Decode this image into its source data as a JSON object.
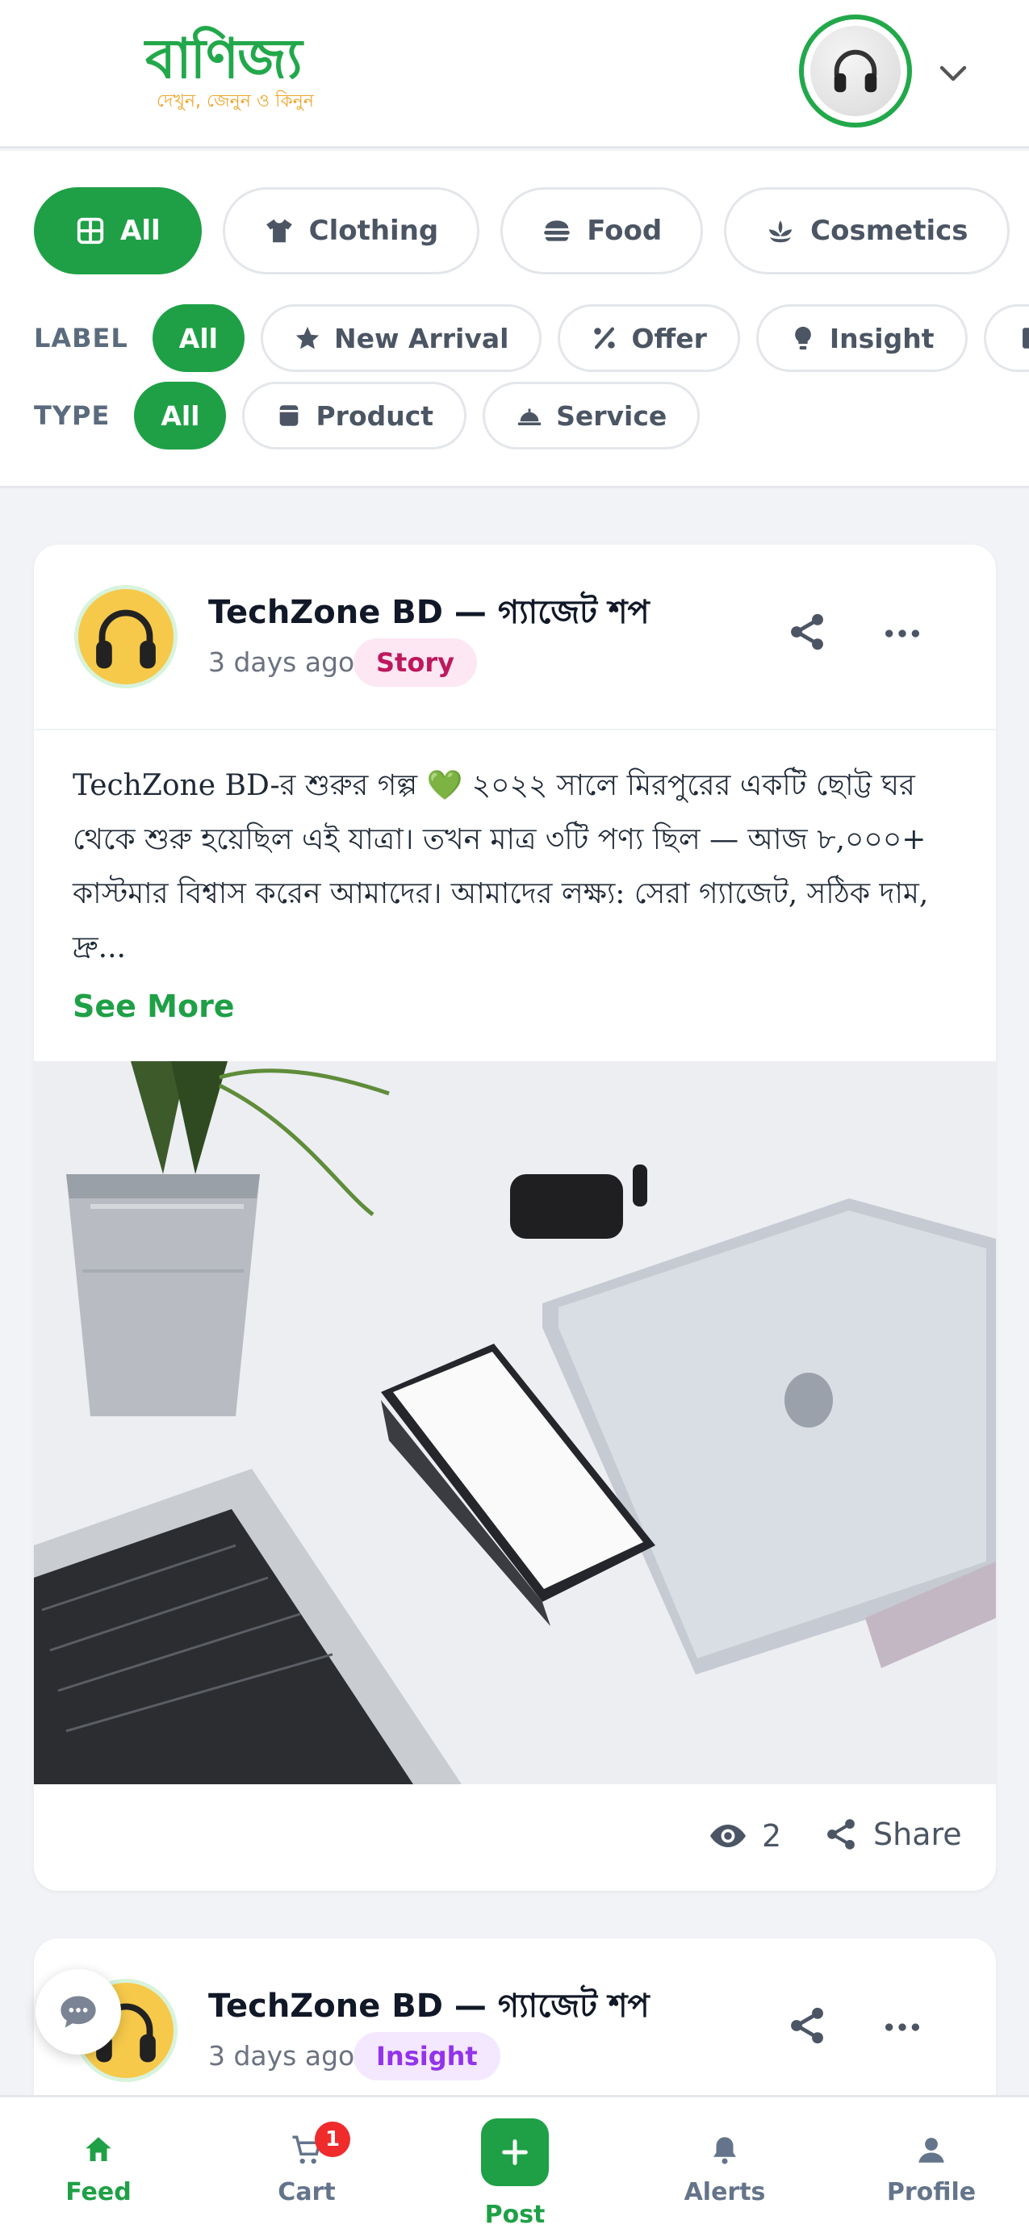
{
  "header": {
    "logo_text": "বাণিজ্য",
    "logo_tagline": "দেখুন, জেনুন ও কিনুন"
  },
  "filters": {
    "categories": [
      {
        "label": "All",
        "icon": "grid-icon",
        "active": true
      },
      {
        "label": "Clothing",
        "icon": "shirt-icon"
      },
      {
        "label": "Food",
        "icon": "burger-icon"
      },
      {
        "label": "Cosmetics",
        "icon": "lotus-icon"
      }
    ],
    "label_row_title": "LABEL",
    "labels": [
      {
        "label": "All",
        "active": true
      },
      {
        "label": "New Arrival",
        "icon": "star-icon"
      },
      {
        "label": "Offer",
        "icon": "percent-icon"
      },
      {
        "label": "Insight",
        "icon": "lightbulb-icon"
      }
    ],
    "type_row_title": "TYPE",
    "types": [
      {
        "label": "All",
        "active": true
      },
      {
        "label": "Product",
        "icon": "box-icon"
      },
      {
        "label": "Service",
        "icon": "bell-service-icon"
      }
    ]
  },
  "posts": [
    {
      "shop_name": "TechZone BD — গ্যাজেট শপ",
      "time": "3 days ago",
      "tag": "Story",
      "text": "TechZone BD-র শুরুর গল্প 💚 ২০২২ সালে মিরপুরের একটি ছোট্ট ঘর থেকে শুরু হয়েছিল এই যাত্রা। তখন মাত্র ৩টি পণ্য ছিল — আজ ৮,০০০+ কাস্টমার বিশ্বাস করেন আমাদের। আমাদের লক্ষ্য: সেরা গ্যাজেট, সঠিক দাম, দ্রু...",
      "see_more": "See More",
      "views": "2",
      "share_label": "Share"
    },
    {
      "shop_name": "TechZone BD — গ্যাজেট শপ",
      "time": "3 days ago",
      "tag": "Insight"
    }
  ],
  "nav": {
    "feed": "Feed",
    "cart": "Cart",
    "cart_badge": "1",
    "post": "Post",
    "alerts": "Alerts",
    "profile": "Profile"
  },
  "colors": {
    "primary": "#1fa046",
    "story_tag": "#be185d",
    "insight_tag": "#9333ea",
    "badge": "#ef2b2b"
  }
}
